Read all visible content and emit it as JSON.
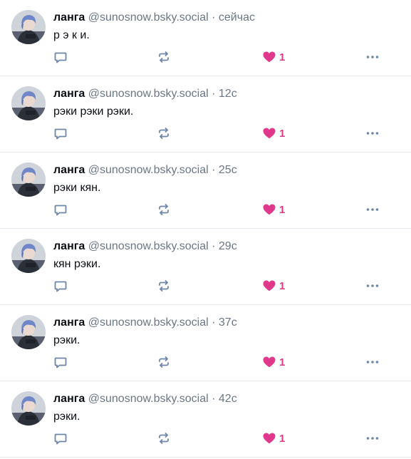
{
  "posts": [
    {
      "name": "ланга",
      "handle": "@sunosnow.bsky.social",
      "separator": "·",
      "time": "сейчас",
      "text": "р э к и.",
      "likes": "1",
      "reply_icon": "comment-icon",
      "repost_icon": "repost-icon",
      "like_icon": "heart-filled-icon",
      "more_icon": "more-dots-icon"
    },
    {
      "name": "ланга",
      "handle": "@sunosnow.bsky.social",
      "separator": "·",
      "time": "12с",
      "text": "рэки рэки рэки.",
      "likes": "1",
      "reply_icon": "comment-icon",
      "repost_icon": "repost-icon",
      "like_icon": "heart-filled-icon",
      "more_icon": "more-dots-icon"
    },
    {
      "name": "ланга",
      "handle": "@sunosnow.bsky.social",
      "separator": "·",
      "time": "25с",
      "text": "рэки кян.",
      "likes": "1",
      "reply_icon": "comment-icon",
      "repost_icon": "repost-icon",
      "like_icon": "heart-filled-icon",
      "more_icon": "more-dots-icon"
    },
    {
      "name": "ланга",
      "handle": "@sunosnow.bsky.social",
      "separator": "·",
      "time": "29с",
      "text": "кян рэки.",
      "likes": "1",
      "reply_icon": "comment-icon",
      "repost_icon": "repost-icon",
      "like_icon": "heart-filled-icon",
      "more_icon": "more-dots-icon"
    },
    {
      "name": "ланга",
      "handle": "@sunosnow.bsky.social",
      "separator": "·",
      "time": "37с",
      "text": "рэки.",
      "likes": "1",
      "reply_icon": "comment-icon",
      "repost_icon": "repost-icon",
      "like_icon": "heart-filled-icon",
      "more_icon": "more-dots-icon"
    },
    {
      "name": "ланга",
      "handle": "@sunosnow.bsky.social",
      "separator": "·",
      "time": "42с",
      "text": "рэки.",
      "likes": "1",
      "reply_icon": "comment-icon",
      "repost_icon": "repost-icon",
      "like_icon": "heart-filled-icon",
      "more_icon": "more-dots-icon"
    }
  ],
  "colors": {
    "like": "#e0388a",
    "icon": "#6e86a8",
    "muted_text": "#6b7785",
    "divider": "#e6e9ee"
  }
}
